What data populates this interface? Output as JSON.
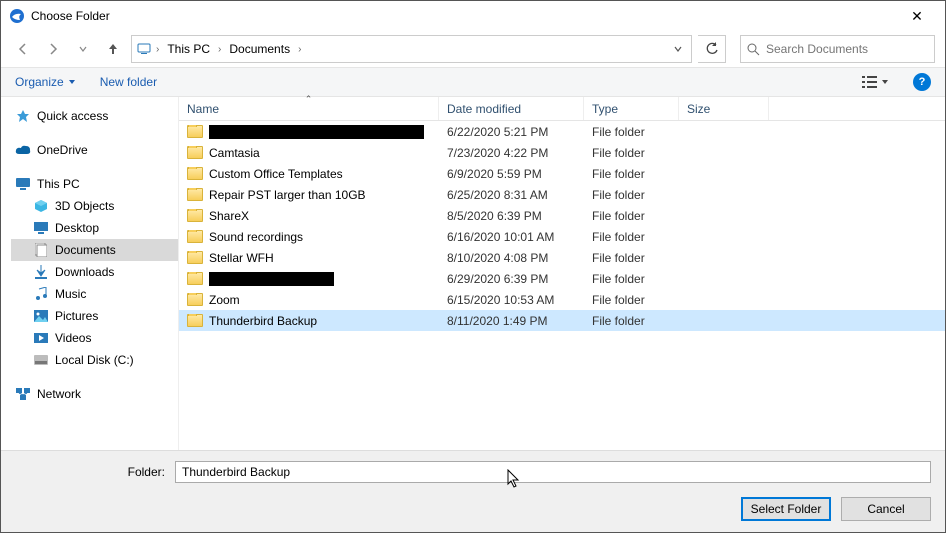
{
  "title": "Choose Folder",
  "breadcrumb": [
    "This PC",
    "Documents"
  ],
  "search_placeholder": "Search Documents",
  "toolbar": {
    "organize": "Organize",
    "new_folder": "New folder"
  },
  "columns": {
    "name": "Name",
    "date": "Date modified",
    "type": "Type",
    "size": "Size"
  },
  "tree": {
    "quick_access": "Quick access",
    "onedrive": "OneDrive",
    "this_pc": "This PC",
    "d3": "3D Objects",
    "desktop": "Desktop",
    "documents": "Documents",
    "downloads": "Downloads",
    "music": "Music",
    "pictures": "Pictures",
    "videos": "Videos",
    "local_disk": "Local Disk (C:)",
    "network": "Network"
  },
  "rows": [
    {
      "name": "",
      "redact": "w1",
      "date": "6/22/2020 5:21 PM",
      "type": "File folder"
    },
    {
      "name": "Camtasia",
      "date": "7/23/2020 4:22 PM",
      "type": "File folder"
    },
    {
      "name": "Custom Office Templates",
      "date": "6/9/2020 5:59 PM",
      "type": "File folder"
    },
    {
      "name": "Repair PST larger than 10GB",
      "date": "6/25/2020 8:31 AM",
      "type": "File folder"
    },
    {
      "name": "ShareX",
      "date": "8/5/2020 6:39 PM",
      "type": "File folder"
    },
    {
      "name": "Sound recordings",
      "date": "6/16/2020 10:01 AM",
      "type": "File folder"
    },
    {
      "name": "Stellar WFH",
      "date": "8/10/2020 4:08 PM",
      "type": "File folder"
    },
    {
      "name": "",
      "redact": "w2",
      "date": "6/29/2020 6:39 PM",
      "type": "File folder"
    },
    {
      "name": "Zoom",
      "date": "6/15/2020 10:53 AM",
      "type": "File folder"
    },
    {
      "name": "Thunderbird Backup",
      "date": "8/11/2020 1:49 PM",
      "type": "File folder",
      "selected": true
    }
  ],
  "folder_label": "Folder:",
  "folder_value": "Thunderbird Backup",
  "buttons": {
    "select": "Select Folder",
    "cancel": "Cancel"
  }
}
